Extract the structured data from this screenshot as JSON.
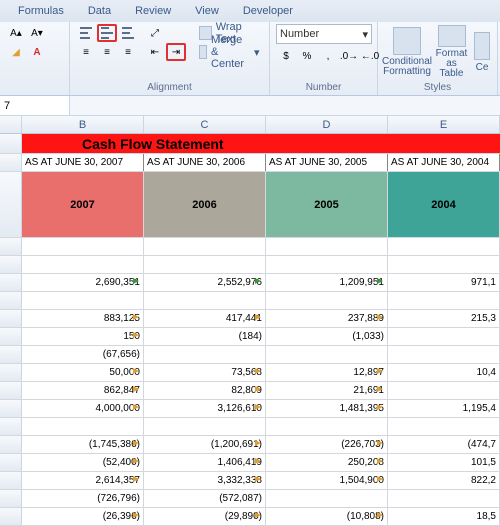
{
  "tabs": {
    "formulas": "Formulas",
    "data": "Data",
    "review": "Review",
    "view": "View",
    "developer": "Developer"
  },
  "ribbon": {
    "alignment_label": "Alignment",
    "number_label": "Number",
    "styles_label": "Styles",
    "wrap": "Wrap Text",
    "merge": "Merge & Center",
    "number_format": "Number",
    "cond_fmt": "Conditional Formatting",
    "fmt_table": "Format as Table",
    "cell_styles": "Ce"
  },
  "formula": {
    "name_box": "7"
  },
  "cols": {
    "B": "B",
    "C": "C",
    "D": "D",
    "E": "E"
  },
  "title": "Cash Flow Statement",
  "asat": {
    "b": "AS AT JUNE 30, 2007",
    "c": "AS AT JUNE 30, 2006",
    "d": "AS AT JUNE 30, 2005",
    "e": "AS AT JUNE 30, 2004"
  },
  "years": {
    "b": "2007",
    "c": "2006",
    "d": "2005",
    "e": "2004"
  },
  "rows": [
    {
      "b": "2,690,351",
      "bf": "g",
      "c": "2,552,976",
      "cf": "g",
      "d": "1,209,951",
      "df": "g",
      "e": "971,1"
    },
    null,
    {
      "b": "883,125",
      "bf": "o",
      "c": "417,441",
      "cf": "o",
      "d": "237,889",
      "df": "o",
      "e": "215,3"
    },
    {
      "b": "150",
      "bf": "o",
      "c": "(184)",
      "cf": "",
      "d": "(1,033)",
      "df": "",
      "e": ""
    },
    {
      "b": "(67,656)",
      "bf": "-",
      "c": "",
      "cf": "",
      "d": "",
      "df": "",
      "e": ""
    },
    {
      "b": "50,000",
      "bf": "o",
      "c": "73,568",
      "cf": "o",
      "d": "12,897",
      "df": "o",
      "e": "10,4"
    },
    {
      "b": "862,847",
      "bf": "o",
      "c": "82,809",
      "cf": "o",
      "d": "21,691",
      "df": "o",
      "e": ""
    },
    {
      "b": "4,000,000",
      "bf": "o",
      "c": "3,126,610",
      "cf": "o",
      "d": "1,481,395",
      "df": "o",
      "e": "1,195,4"
    },
    null,
    {
      "b": "(1,745,386)",
      "bf": "o",
      "c": "(1,200,691)",
      "cf": "o",
      "d": "(226,703)",
      "df": "o",
      "e": "(474,7"
    },
    {
      "b": "(52,400)",
      "bf": "o",
      "c": "1,406,419",
      "cf": "o",
      "d": "250,208",
      "df": "o",
      "e": "101,5"
    },
    {
      "b": "2,614,357",
      "bf": "o",
      "c": "3,332,338",
      "cf": "o",
      "d": "1,504,900",
      "df": "o",
      "e": "822,2"
    },
    {
      "b": "(726,796)",
      "bf": "",
      "c": "(572,087)",
      "cf": "",
      "d": "",
      "df": "",
      "e": ""
    },
    {
      "b": "(26,396)",
      "bf": "o",
      "c": "(29,890)",
      "cf": "o",
      "d": "(10,808)",
      "df": "o",
      "e": "18,5"
    }
  ]
}
